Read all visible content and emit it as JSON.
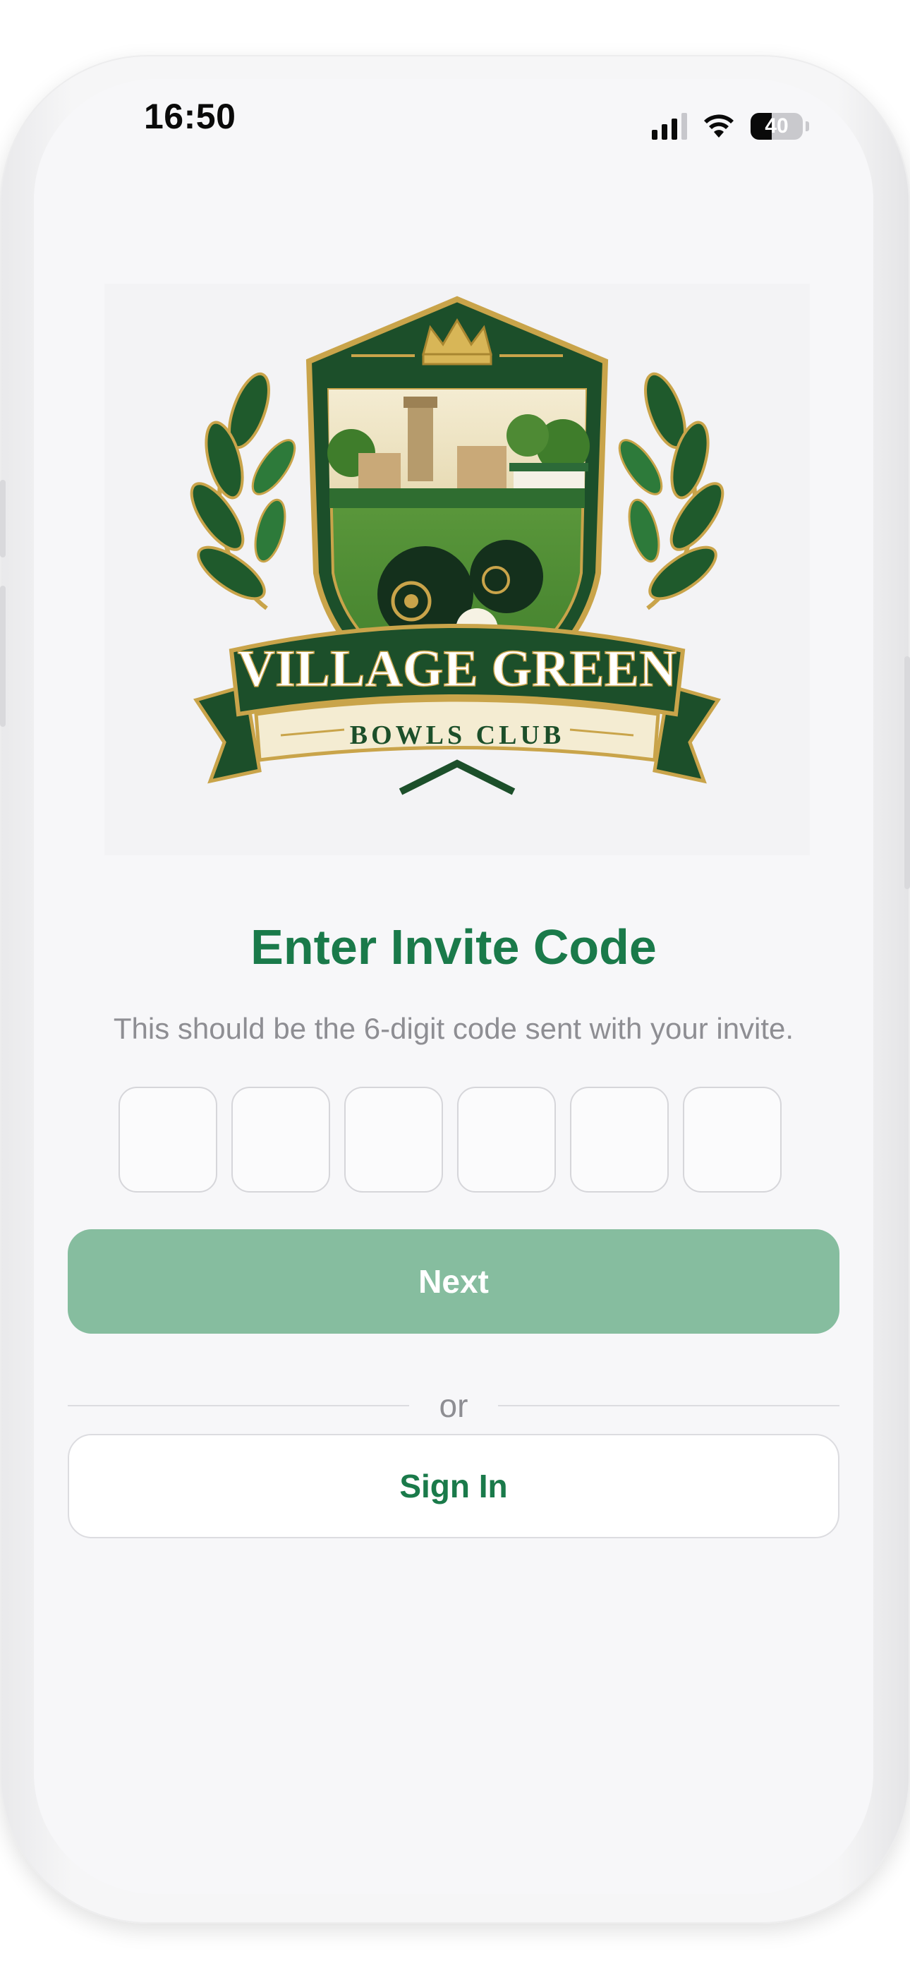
{
  "status_bar": {
    "time": "16:50",
    "battery_level": "40",
    "signal_bars_active": 3,
    "signal_bars_total": 4,
    "icons": [
      "signal-icon",
      "wifi-icon",
      "battery-icon"
    ]
  },
  "logo": {
    "name_line1": "VILLAGE GREEN",
    "name_line2": "BOWLS CLUB",
    "icons": [
      "crown-icon",
      "laurel-icon",
      "bowls-ball-icon"
    ]
  },
  "form": {
    "title": "Enter Invite Code",
    "subtitle": "This should be the 6-digit code sent with your invite.",
    "code_digits": [
      "",
      "",
      "",
      "",
      "",
      ""
    ],
    "next_label": "Next",
    "divider_text": "or",
    "signin_label": "Sign In"
  },
  "colors": {
    "brand_green": "#1a7a4a",
    "next_button_disabled": "#86bd9f",
    "background": "#f7f7f9",
    "muted_text": "#8e8e93"
  }
}
